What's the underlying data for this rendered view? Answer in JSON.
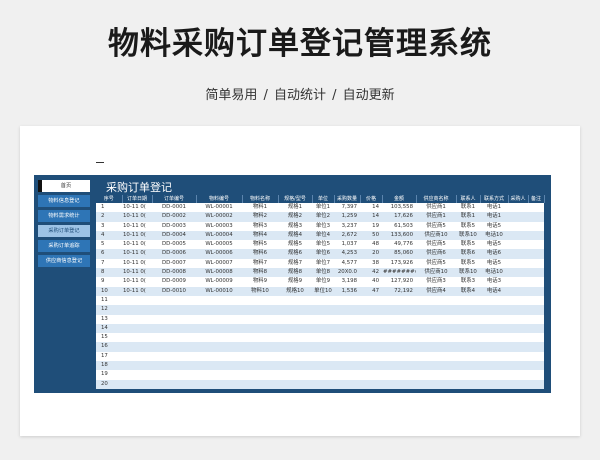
{
  "banner": {
    "title": "物料采购订单登记管理系统",
    "subtitle": "简单易用  /  自动统计  /  自动更新"
  },
  "sidebar": {
    "items": [
      {
        "label": "首页"
      },
      {
        "label": "物料信息登记"
      },
      {
        "label": "物料需求统计"
      },
      {
        "label": "采购订单登记"
      },
      {
        "label": "采购订单追踪"
      },
      {
        "label": "供应商信息登记"
      }
    ],
    "active": "采购订单登记"
  },
  "panel": {
    "title": "采购订单登记"
  },
  "table": {
    "columns": [
      "序号",
      "订单日期",
      "订单编号",
      "物料编号",
      "物料名称",
      "规格/型号",
      "单位",
      "采购数量",
      "价格",
      "金额",
      "供应商名称",
      "联系人",
      "联系方式",
      "采购人",
      "备注"
    ],
    "rows": [
      [
        "1",
        "10-11 0(",
        "DD-0001",
        "WL-00001",
        "物料1",
        "规格1",
        "单位1",
        "7,397",
        "14",
        "103,558",
        "供应商1",
        "联系1",
        "电话1",
        "",
        ""
      ],
      [
        "2",
        "10-11 0(",
        "DD-0002",
        "WL-00002",
        "物料2",
        "规格2",
        "单位2",
        "1,259",
        "14",
        "17,626",
        "供应商1",
        "联系1",
        "电话1",
        "",
        ""
      ],
      [
        "3",
        "10-11 0(",
        "DD-0003",
        "WL-00003",
        "物料3",
        "规格3",
        "单位3",
        "3,237",
        "19",
        "61,503",
        "供应商5",
        "联系5",
        "电话5",
        "",
        ""
      ],
      [
        "4",
        "10-11 0(",
        "DD-0004",
        "WL-00004",
        "物料4",
        "规格4",
        "单位4",
        "2,672",
        "50",
        "133,600",
        "供应商10",
        "联系10",
        "电话10",
        "",
        ""
      ],
      [
        "5",
        "10-11 0(",
        "DD-0005",
        "WL-00005",
        "物料5",
        "规格5",
        "单位5",
        "1,037",
        "48",
        "49,776",
        "供应商5",
        "联系5",
        "电话5",
        "",
        ""
      ],
      [
        "6",
        "10-11 0(",
        "DD-0006",
        "WL-00006",
        "物料6",
        "规格6",
        "单位6",
        "4,253",
        "20",
        "85,060",
        "供应商6",
        "联系6",
        "电话6",
        "",
        ""
      ],
      [
        "7",
        "10-11 0(",
        "DD-0007",
        "WL-00007",
        "物料7",
        "规格7",
        "单位7",
        "4,577",
        "38",
        "173,926",
        "供应商5",
        "联系5",
        "电话5",
        "",
        ""
      ],
      [
        "8",
        "10-11 0(",
        "DD-0008",
        "WL-00008",
        "物料8",
        "规格8",
        "单位8",
        "20X0.0",
        "42",
        "########",
        "供应商10",
        "联系10",
        "电话10",
        "",
        ""
      ],
      [
        "9",
        "10-11 0(",
        "DD-0009",
        "WL-00009",
        "物料9",
        "规格9",
        "单位9",
        "3,198",
        "40",
        "127,920",
        "供应商3",
        "联系3",
        "电话3",
        "",
        ""
      ],
      [
        "10",
        "10-11 0(",
        "DD-0010",
        "WL-00010",
        "物料10",
        "规格10",
        "单位10",
        "1,536",
        "47",
        "72,192",
        "供应商4",
        "联系4",
        "电话4",
        "",
        ""
      ],
      [
        "11",
        "",
        "",
        "",
        "",
        "",
        "",
        "",
        "",
        "",
        "",
        "",
        "",
        "",
        ""
      ],
      [
        "12",
        "",
        "",
        "",
        "",
        "",
        "",
        "",
        "",
        "",
        "",
        "",
        "",
        "",
        ""
      ],
      [
        "13",
        "",
        "",
        "",
        "",
        "",
        "",
        "",
        "",
        "",
        "",
        "",
        "",
        "",
        ""
      ],
      [
        "14",
        "",
        "",
        "",
        "",
        "",
        "",
        "",
        "",
        "",
        "",
        "",
        "",
        "",
        ""
      ],
      [
        "15",
        "",
        "",
        "",
        "",
        "",
        "",
        "",
        "",
        "",
        "",
        "",
        "",
        "",
        ""
      ],
      [
        "16",
        "",
        "",
        "",
        "",
        "",
        "",
        "",
        "",
        "",
        "",
        "",
        "",
        "",
        ""
      ],
      [
        "17",
        "",
        "",
        "",
        "",
        "",
        "",
        "",
        "",
        "",
        "",
        "",
        "",
        "",
        ""
      ],
      [
        "18",
        "",
        "",
        "",
        "",
        "",
        "",
        "",
        "",
        "",
        "",
        "",
        "",
        "",
        ""
      ],
      [
        "19",
        "",
        "",
        "",
        "",
        "",
        "",
        "",
        "",
        "",
        "",
        "",
        "",
        "",
        ""
      ],
      [
        "20",
        "",
        "",
        "",
        "",
        "",
        "",
        "",
        "",
        "",
        "",
        "",
        "",
        "",
        ""
      ]
    ]
  },
  "colors": {
    "frame": "#1f4e79",
    "nav": "#2e75b6",
    "nav_active": "#9dc3e6",
    "row_alt": "#dbe8f4"
  }
}
